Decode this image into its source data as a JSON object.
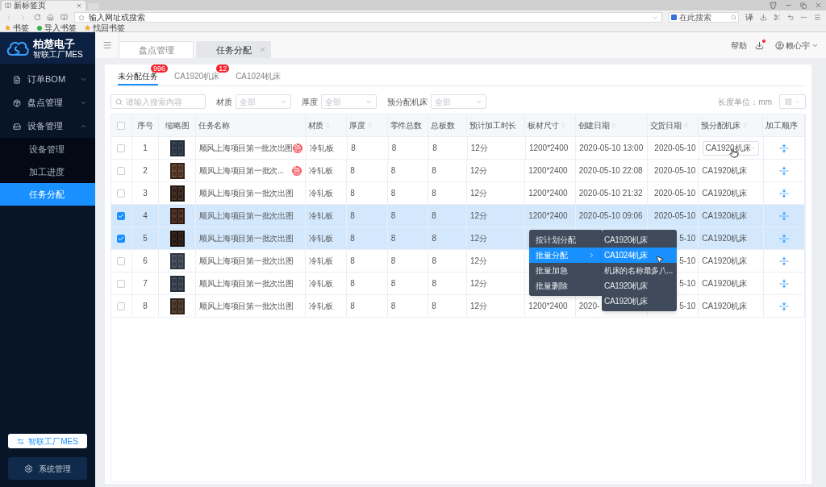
{
  "browser": {
    "tab_title": "新标签页",
    "address_placeholder": "输入网址或搜索",
    "search_placeholder": "在此搜索",
    "translate": "译",
    "bookmarks": [
      "书签",
      "导入书签",
      "找回书签"
    ]
  },
  "sidebar": {
    "brand": "柏楚电子",
    "subtitle": "智联工厂MES",
    "items": [
      {
        "label": "订单BOM",
        "expanded": false
      },
      {
        "label": "盘点管理",
        "expanded": false
      },
      {
        "label": "设备管理",
        "expanded": true,
        "children": [
          {
            "label": "设备管理",
            "selected": false
          },
          {
            "label": "加工进度",
            "selected": false
          },
          {
            "label": "任务分配",
            "selected": true
          }
        ]
      }
    ],
    "mes_button": "智联工厂MES",
    "settings_button": "系统管理"
  },
  "header": {
    "page_tabs": [
      {
        "label": "盘点管理",
        "selected": false,
        "closable": false
      },
      {
        "label": "任务分配",
        "selected": true,
        "closable": true
      }
    ],
    "help": "帮助",
    "notification": true,
    "user": "赖心宇"
  },
  "task_tabs": [
    {
      "label": "未分配任务",
      "badge": "996",
      "selected": true
    },
    {
      "label": "CA1920机床",
      "badge": "12",
      "selected": false
    },
    {
      "label": "CA1024机床",
      "selected": false
    }
  ],
  "filters": {
    "search_placeholder": "请输入搜索内容",
    "selects": [
      {
        "label": "材质",
        "value": "全部"
      },
      {
        "label": "厚度",
        "value": "全部"
      },
      {
        "label": "预分配机床",
        "value": "全部"
      }
    ],
    "unit": "长度单位：mm"
  },
  "table": {
    "select_all": false,
    "columns": [
      {
        "label": "序号",
        "sortable": false
      },
      {
        "label": "缩略图",
        "sortable": false
      },
      {
        "label": "任务名称",
        "sortable": false
      },
      {
        "label": "材质",
        "sortable": true
      },
      {
        "label": "厚度",
        "sortable": true
      },
      {
        "label": "零件总数",
        "sortable": false
      },
      {
        "label": "总板数",
        "sortable": false
      },
      {
        "label": "预计加工时长",
        "sortable": false
      },
      {
        "label": "板材尺寸",
        "sortable": true
      },
      {
        "label": "创建日期",
        "sortable": true
      },
      {
        "label": "交货日期",
        "sortable": true
      },
      {
        "label": "预分配机床",
        "sortable": true
      },
      {
        "label": "加工顺序",
        "sortable": false
      }
    ],
    "rows": [
      {
        "selected": false,
        "index": "1",
        "name": "顺风上海项目第一批次出图",
        "badge": "急",
        "material": "冷轧板",
        "thickness": "8",
        "parts": "8",
        "boards": "8",
        "duration": "12分",
        "size": "1200*2400",
        "created": "2020-05-10 13:00",
        "delivery": "2020-05-10",
        "machine": "CA1920机床",
        "machine_dropdown": true
      },
      {
        "selected": false,
        "index": "2",
        "name": "顺风上海项目第一批次...",
        "badge": "急",
        "material": "冷轧板",
        "thickness": "8",
        "parts": "8",
        "boards": "8",
        "duration": "12分",
        "size": "1200*2400",
        "created": "2020-05-10 22:08",
        "delivery": "2020-05-10",
        "machine": "CA1920机床",
        "machine_dropdown": false
      },
      {
        "selected": false,
        "index": "3",
        "name": "顺风上海项目第一批次出图",
        "material": "冷轧板",
        "thickness": "8",
        "parts": "8",
        "boards": "8",
        "duration": "12分",
        "size": "1200*2400",
        "created": "2020-05-10 21:32",
        "delivery": "2020-05-10",
        "machine": "CA1920机床",
        "machine_dropdown": false
      },
      {
        "selected": true,
        "index": "4",
        "name": "顺风上海项目第一批次出图",
        "material": "冷轧板",
        "thickness": "8",
        "parts": "8",
        "boards": "8",
        "duration": "12分",
        "size": "1200*2400",
        "created": "2020-05-10 09:06",
        "delivery": "2020-05-10",
        "machine": "CA1920机床",
        "machine_dropdown": false
      },
      {
        "selected": true,
        "index": "5",
        "name": "顺风上海项目第一批次出图",
        "material": "冷轧板",
        "thickness": "8",
        "parts": "8",
        "boards": "8",
        "duration": "12分",
        "delivery": "5-10",
        "machine": "CA1920机床",
        "machine_dropdown": false
      },
      {
        "selected": false,
        "index": "6",
        "name": "顺风上海项目第一批次出图",
        "material": "冷轧板",
        "thickness": "8",
        "parts": "8",
        "boards": "8",
        "duration": "12分",
        "delivery": "5-10",
        "machine": "CA1920机床",
        "machine_dropdown": false
      },
      {
        "selected": false,
        "index": "7",
        "name": "顺风上海项目第一批次出图",
        "material": "冷轧板",
        "thickness": "8",
        "parts": "8",
        "boards": "8",
        "duration": "12分",
        "delivery": "5-10",
        "machine": "CA1920机床",
        "machine_dropdown": false
      },
      {
        "selected": false,
        "index": "8",
        "name": "顺风上海项目第一批次出图",
        "material": "冷轧板",
        "thickness": "8",
        "parts": "8",
        "boards": "8",
        "duration": "12分",
        "size": "1200*2400",
        "created": "2020-",
        "delivery": "5-10",
        "machine": "CA1920机床",
        "machine_dropdown": false
      }
    ]
  },
  "context_menu": {
    "items": [
      {
        "label": "按计划分配",
        "selected": false,
        "has_submenu": false
      },
      {
        "label": "批量分配",
        "selected": true,
        "has_submenu": true
      },
      {
        "label": "批量加急",
        "selected": false,
        "has_submenu": false
      },
      {
        "label": "批量删除",
        "selected": false,
        "has_submenu": false
      }
    ],
    "submenu": [
      {
        "label": "CA1920机床",
        "selected": false
      },
      {
        "label": "CA1024机床",
        "selected": true
      },
      {
        "label": "机床的名称最多八...",
        "selected": false
      },
      {
        "label": "CA1920机床",
        "selected": false
      },
      {
        "label": "CA1920机床",
        "selected": false
      }
    ]
  }
}
